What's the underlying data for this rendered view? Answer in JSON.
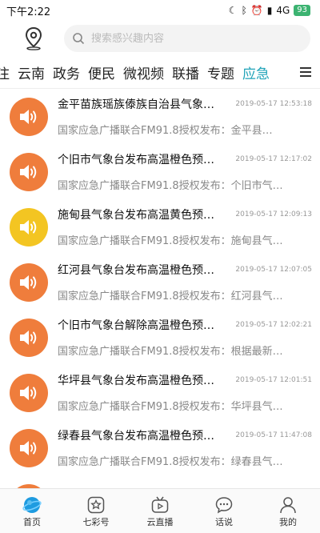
{
  "status": {
    "time": "下午2:22",
    "network": "4G",
    "battery": "93"
  },
  "search": {
    "placeholder": "搜索感兴趣内容"
  },
  "tabs": [
    {
      "label": "注",
      "active": false
    },
    {
      "label": "云南",
      "active": false
    },
    {
      "label": "政务",
      "active": false
    },
    {
      "label": "便民",
      "active": false
    },
    {
      "label": "微视频",
      "active": false
    },
    {
      "label": "联播",
      "active": false
    },
    {
      "label": "专题",
      "active": false
    },
    {
      "label": "应急",
      "active": true
    }
  ],
  "items": [
    {
      "title": "金平苗族瑶族傣族自治县气象…",
      "time": "2019-05-17 12:53:18",
      "desc": "国家应急广播联合FM91.8授权发布：金平县…",
      "color": "#ef7d3c"
    },
    {
      "title": "个旧市气象台发布高温橙色预…",
      "time": "2019-05-17 12:17:02",
      "desc": "国家应急广播联合FM91.8授权发布：个旧市气…",
      "color": "#ef7d3c"
    },
    {
      "title": "施甸县气象台发布高温黄色预…",
      "time": "2019-05-17 12:09:13",
      "desc": "国家应急广播联合FM91.8授权发布：施甸县气…",
      "color": "#f3c522"
    },
    {
      "title": "红河县气象台发布高温橙色预…",
      "time": "2019-05-17 12:07:05",
      "desc": "国家应急广播联合FM91.8授权发布：红河县气…",
      "color": "#ef7d3c"
    },
    {
      "title": "个旧市气象台解除高温橙色预…",
      "time": "2019-05-17 12:02:21",
      "desc": "国家应急广播联合FM91.8授权发布：根据最新…",
      "color": "#ef7d3c"
    },
    {
      "title": "华坪县气象台发布高温橙色预…",
      "time": "2019-05-17 12:01:51",
      "desc": "国家应急广播联合FM91.8授权发布：华坪县气…",
      "color": "#ef7d3c"
    },
    {
      "title": "绿春县气象台发布高温橙色预…",
      "time": "2019-05-17 11:47:08",
      "desc": "国家应急广播联合FM91.8授权发布：绿春县气…",
      "color": "#ef7d3c"
    },
    {
      "title": "",
      "time": "",
      "desc": "",
      "color": "#ef7d3c"
    }
  ],
  "nav": [
    {
      "label": "首页",
      "icon": "home-globe-icon"
    },
    {
      "label": "七彩号",
      "icon": "star-icon"
    },
    {
      "label": "云直播",
      "icon": "tv-icon"
    },
    {
      "label": "话说",
      "icon": "chat-icon"
    },
    {
      "label": "我的",
      "icon": "user-icon"
    }
  ],
  "colors": {
    "accent": "#1fa3b8",
    "orange": "#ef7d3c",
    "yellow": "#f3c522"
  }
}
